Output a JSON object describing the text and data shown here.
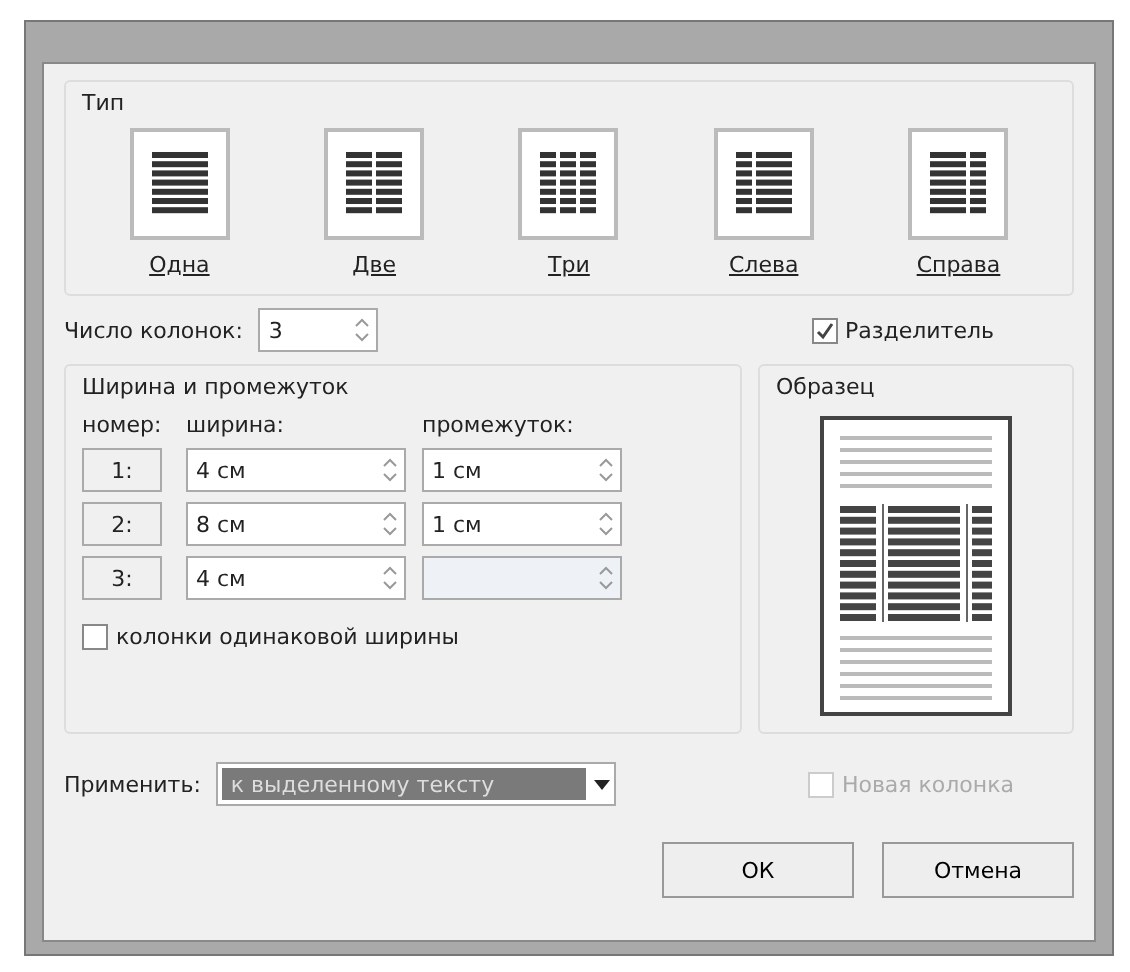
{
  "type_group": {
    "label": "Тип",
    "presets": [
      {
        "kind": "one",
        "label": "Одна",
        "selected": false
      },
      {
        "kind": "two",
        "label": "Две",
        "selected": false
      },
      {
        "kind": "three",
        "label": "Три",
        "selected": false
      },
      {
        "kind": "left",
        "label": "Слева",
        "selected": false
      },
      {
        "kind": "right",
        "label": "Справа",
        "selected": false
      }
    ]
  },
  "count": {
    "label": "Число колонок:",
    "value": "3"
  },
  "separator": {
    "label": "Разделитель",
    "checked": true
  },
  "width_group": {
    "label": "Ширина и промежуток",
    "headers": [
      "номер:",
      "ширина:",
      "промежуток:"
    ],
    "rows": [
      {
        "number": "1:",
        "width": "4 см",
        "spacing": "1 см",
        "spacing_disabled": false
      },
      {
        "number": "2:",
        "width": "8 см",
        "spacing": "1 см",
        "spacing_disabled": false
      },
      {
        "number": "3:",
        "width": "4 см",
        "spacing_disabled": true
      }
    ],
    "equal": {
      "label": "колонки одинаковой ширины",
      "checked": false
    }
  },
  "sample": {
    "label": "Образец"
  },
  "apply": {
    "label": "Применить:",
    "value": "к выделенному тексту"
  },
  "new_column": {
    "label": "Новая колонка",
    "checked": false,
    "disabled": true
  },
  "buttons": [
    "ОК",
    "Отмена"
  ]
}
